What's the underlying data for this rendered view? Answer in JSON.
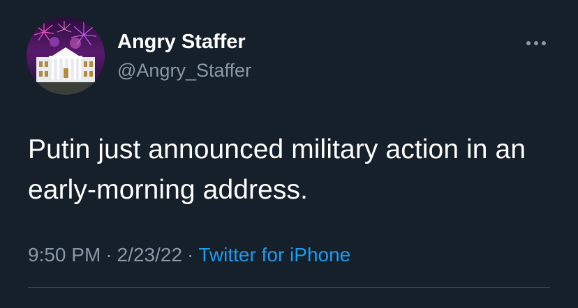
{
  "tweet": {
    "author": {
      "display_name": "Angry Staffer",
      "handle": "@Angry_Staffer"
    },
    "text": "Putin just announced military action in an early-morning address.",
    "time": "9:50 PM",
    "separator": "·",
    "date": "2/23/22",
    "source": "Twitter for iPhone"
  },
  "icons": {
    "more": "more-horizontal-icon",
    "avatar": "white-house-fireworks-avatar"
  },
  "colors": {
    "background": "#15202b",
    "text": "#ffffff",
    "secondary": "#8b98a5",
    "link": "#1d9bf0",
    "divider": "#38444d"
  }
}
